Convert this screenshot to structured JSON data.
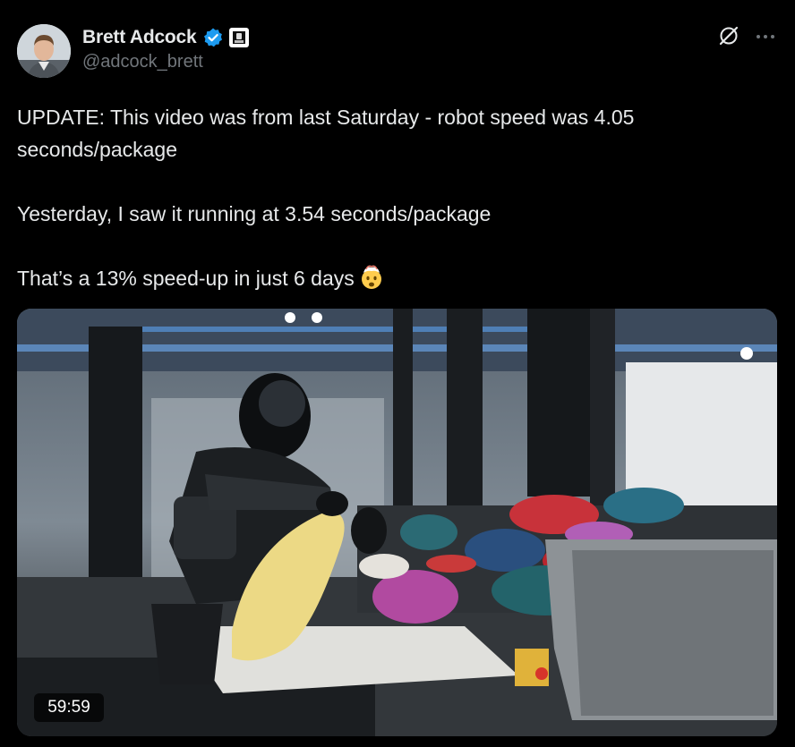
{
  "author": {
    "display_name": "Brett Adcock",
    "handle": "@adcock_brett",
    "verified_icon": "verified-badge-icon",
    "affiliation_icon": "company-logo-icon",
    "accent_color": "#1d9bf0"
  },
  "actions": {
    "grok_icon": "grok-icon",
    "more_icon": "more-dots-icon"
  },
  "tweet": {
    "line1": "UPDATE: This video was from last Saturday - robot speed was 4.05 seconds/package",
    "line2": "Yesterday, I saw it running at 3.54 seconds/package",
    "line3": "That’s a 13% speed-up in just 6 days",
    "emoji_icon": "exploding-head-emoji"
  },
  "media": {
    "type": "video",
    "duration": "59:59"
  }
}
